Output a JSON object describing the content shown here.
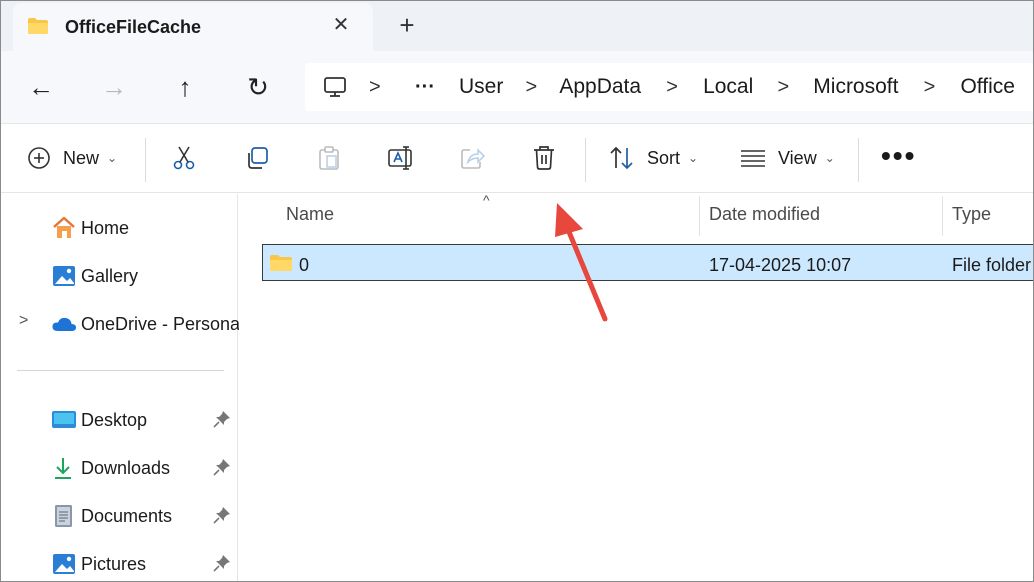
{
  "window": {
    "tab_title": "OfficeFileCache",
    "tab_close": "✕",
    "new_tab": "+"
  },
  "navigation": {
    "back": "←",
    "forward": "→",
    "up": "↑",
    "refresh": "↻"
  },
  "address_bar": {
    "overflow": "···",
    "separator": ">",
    "crumbs": [
      "User",
      "AppData",
      "Local",
      "Microsoft",
      "Office"
    ]
  },
  "command_bar": {
    "new_label": "New",
    "sort_label": "Sort",
    "view_label": "View",
    "more": "•••",
    "chevron": "⌄",
    "icons": [
      "add-icon",
      "cut-icon",
      "copy-icon",
      "paste-icon",
      "rename-icon",
      "share-icon",
      "delete-icon",
      "sort-icon",
      "view-icon",
      "more-icon"
    ]
  },
  "sidebar": {
    "expand_glyph": ">",
    "primary": [
      {
        "label": "Home",
        "icon": "home-icon"
      },
      {
        "label": "Gallery",
        "icon": "gallery-icon"
      },
      {
        "label": "OneDrive - Persona",
        "icon": "onedrive-icon"
      }
    ],
    "quick_access": [
      {
        "label": "Desktop",
        "icon": "desktop-icon"
      },
      {
        "label": "Downloads",
        "icon": "downloads-icon"
      },
      {
        "label": "Documents",
        "icon": "documents-icon"
      },
      {
        "label": "Pictures",
        "icon": "pictures-icon"
      }
    ]
  },
  "file_list": {
    "columns": [
      "Name",
      "Date modified",
      "Type"
    ],
    "sort_caret": "^",
    "rows": [
      {
        "name": "0",
        "date_modified": "17-04-2025 10:07",
        "type": "File folder",
        "selected": true
      }
    ]
  },
  "colors": {
    "selection_bg": "#cce8ff",
    "folder_yellow": "#f8c74a",
    "arrow_red": "#e8473d",
    "accent_blue": "#0a64c8"
  }
}
